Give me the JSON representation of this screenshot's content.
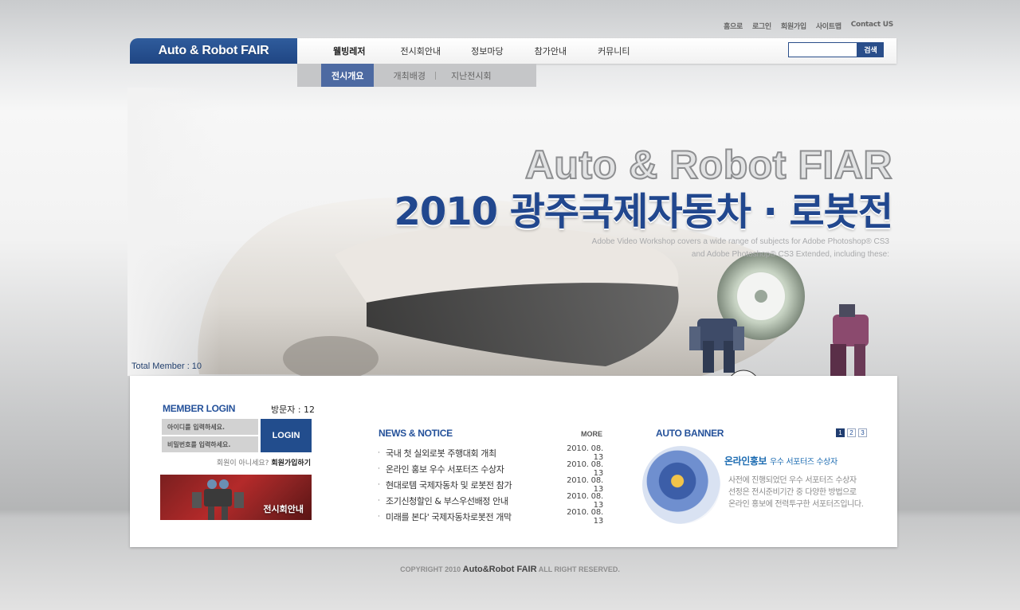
{
  "util_links": [
    "홈으로",
    "로그인",
    "회원가입",
    "사이트맵",
    "Contact US"
  ],
  "logo": "Auto & Robot FAIR",
  "gnb": {
    "items": [
      "웰빙레저",
      "전시회안내",
      "정보마당",
      "참가안내",
      "커뮤니티"
    ],
    "active_index": 0
  },
  "search": {
    "value": "",
    "button": "검색"
  },
  "submenu": {
    "items": [
      "전시개요",
      "개최배경",
      "지난전시회"
    ],
    "active_index": 0
  },
  "hero": {
    "title_en": "Auto & Robot FIAR",
    "title_ko": "2010 광주국제자동차 · 로봇전",
    "desc_line1": "Adobe Video Workshop covers a wide range of subjects for Adobe Photoshop® CS3",
    "desc_line2": "and Adobe Photoshop® CS3 Extended, including these:"
  },
  "total_member": "Total Member : 10",
  "login": {
    "title": "MEMBER LOGIN",
    "visitor": "방문자 : 12",
    "id_placeholder": "아이디를 입력하세요.",
    "pw_placeholder": "비밀번호를 입력하세요.",
    "button": "LOGIN",
    "join_prompt": "회원이 아니세요?",
    "join_link": "회원가입하기",
    "exhibit_label": "전시회안내"
  },
  "news": {
    "title": "NEWS & NOTICE",
    "more": "MORE",
    "items": [
      {
        "title": "국내 첫 실외로봇 주행대회 개최",
        "date": "2010. 08. 13"
      },
      {
        "title": "온라인 홍보 우수 서포터즈 수상자",
        "date": "2010. 08. 13"
      },
      {
        "title": "현대로템 국제자동차 및 로봇전 참가",
        "date": "2010. 08. 13"
      },
      {
        "title": "조기신청할인 & 부스우선배정 안내",
        "date": "2010. 08. 13"
      },
      {
        "title": "미래를 본다' 국제자동차로봇전 개막",
        "date": "2010. 08. 13"
      }
    ]
  },
  "banner": {
    "title": "AUTO BANNER",
    "pages": [
      "1",
      "2",
      "3"
    ],
    "active_page": 0,
    "headline": "온라인홍보",
    "headline_sub": "우수 서포터즈 수상자",
    "text_lines": [
      "사전에 진행되었던 우수 서포터즈 수상자",
      "선정은 전시준비기간 중 다양한 방법으로",
      "온라인 홍보에 전력투구한 서포터즈입니다."
    ]
  },
  "footer": {
    "prefix": "COPYRIGHT 2010",
    "brand": "Auto&Robot FAIR",
    "suffix": "ALL RIGHT RESERVED."
  },
  "colors": {
    "brand_blue": "#224d8d",
    "title_blue": "#24519a",
    "sub_active": "#4d6aa2"
  }
}
